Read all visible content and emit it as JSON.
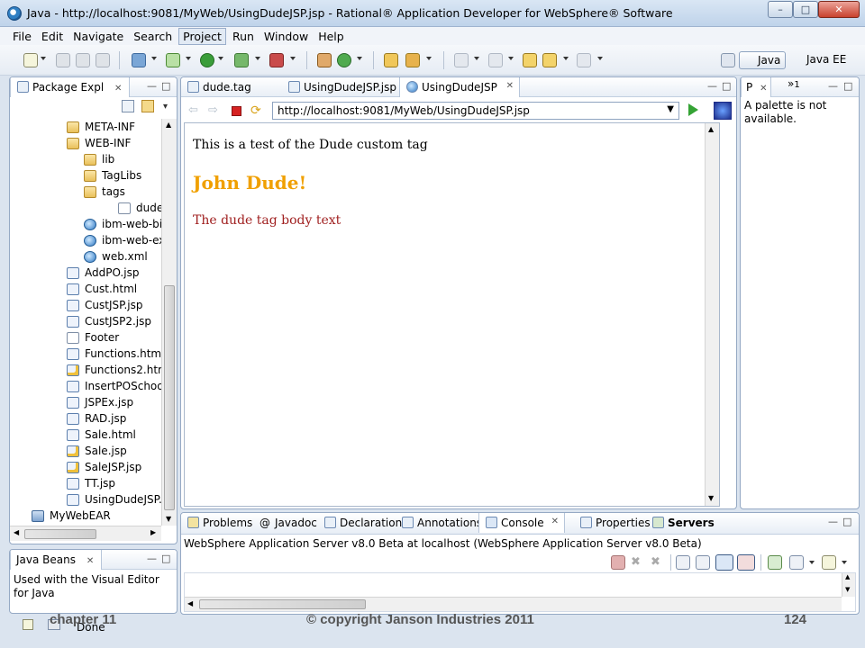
{
  "window": {
    "title": "Java - http://localhost:9081/MyWeb/UsingDudeJSP.jsp - Rational® Application Developer for WebSphere® Software",
    "controls": [
      "minimize",
      "maximize",
      "close"
    ]
  },
  "menu": [
    "File",
    "Edit",
    "Navigate",
    "Search",
    "Project",
    "Run",
    "Window",
    "Help"
  ],
  "menu_active": "Project",
  "perspectives": {
    "java": "Java",
    "javaee": "Java EE"
  },
  "package_explorer": {
    "tab": "Package Expl",
    "items": [
      {
        "label": "META-INF",
        "icon": "folder-icon"
      },
      {
        "label": "WEB-INF",
        "icon": "folder-icon"
      },
      {
        "label": "lib",
        "icon": "folder-icon"
      },
      {
        "label": "TagLibs",
        "icon": "folder-icon"
      },
      {
        "label": "tags",
        "icon": "folder-icon"
      },
      {
        "label": "dude.tag",
        "icon": "file-icon"
      },
      {
        "label": "ibm-web-bi",
        "icon": "web-icon"
      },
      {
        "label": "ibm-web-ex",
        "icon": "web-icon"
      },
      {
        "label": "web.xml",
        "icon": "web-icon"
      },
      {
        "label": "AddPO.jsp",
        "icon": "jsp-icon"
      },
      {
        "label": "Cust.html",
        "icon": "jsp-icon"
      },
      {
        "label": "CustJSP.jsp",
        "icon": "jsp-icon"
      },
      {
        "label": "CustJSP2.jsp",
        "icon": "jsp-icon"
      },
      {
        "label": "Footer",
        "icon": "file-icon"
      },
      {
        "label": "Functions.html",
        "icon": "jsp-icon"
      },
      {
        "label": "Functions2.htm",
        "icon": "warn-icon"
      },
      {
        "label": "InsertPOSchool",
        "icon": "jsp-icon"
      },
      {
        "label": "JSPEx.jsp",
        "icon": "jsp-icon"
      },
      {
        "label": "RAD.jsp",
        "icon": "jsp-icon"
      },
      {
        "label": "Sale.html",
        "icon": "jsp-icon"
      },
      {
        "label": "Sale.jsp",
        "icon": "warn-icon"
      },
      {
        "label": "SaleJSP.jsp",
        "icon": "warn-icon"
      },
      {
        "label": "TT.jsp",
        "icon": "jsp-icon"
      },
      {
        "label": "UsingDudeJSP.j",
        "icon": "jsp-icon"
      },
      {
        "label": "MyWebEAR",
        "icon": "ear-icon"
      }
    ]
  },
  "java_beans": {
    "tab": "Java Beans",
    "text": "Used with the Visual Editor for Java"
  },
  "editor": {
    "tabs": [
      "dude.tag",
      "UsingDudeJSP.jsp",
      "UsingDudeJSP"
    ],
    "active_tab": "UsingDudeJSP",
    "url": "http://localhost:9081/MyWeb/UsingDudeJSP.jsp",
    "content": {
      "line1": "This is a test of the Dude custom tag",
      "heading": "John Dude!",
      "body": "The dude tag body text",
      "heading_color": "#f0a000",
      "body_color": "#a02020"
    }
  },
  "palette": {
    "tab": "P",
    "overflow": "1",
    "text": "A palette is not available."
  },
  "bottom_panel": {
    "tabs": [
      "Problems",
      "Javadoc",
      "Declaration",
      "Annotations",
      "Console",
      "Properties",
      "Servers"
    ],
    "active_tab": "Console",
    "server_line": "WebSphere Application Server v8.0 Beta at localhost (WebSphere Application Server v8.0 Beta)"
  },
  "footer": {
    "chapter": "chapter 11",
    "copyright": "© copyright Janson Industries 2011",
    "page": "124",
    "status": "Done"
  }
}
